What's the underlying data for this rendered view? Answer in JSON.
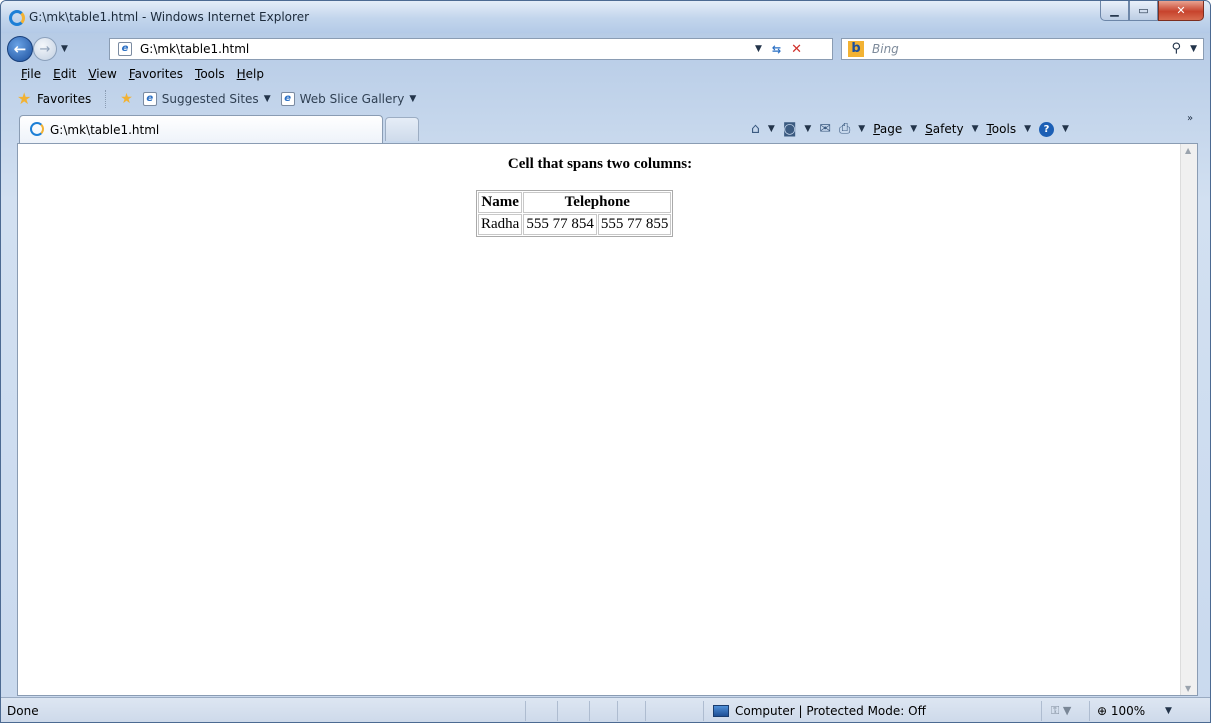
{
  "window": {
    "title": "G:\\mk\\table1.html - Windows Internet Explorer",
    "minimize": "▁",
    "maximize": "▭",
    "close": "✕"
  },
  "address": {
    "url": "G:\\mk\\table1.html",
    "search_placeholder": "Bing"
  },
  "menu": [
    "File",
    "Edit",
    "View",
    "Favorites",
    "Tools",
    "Help"
  ],
  "favorites_bar": {
    "favorites_label": "Favorites",
    "suggested_sites": "Suggested Sites",
    "web_slice_gallery": "Web Slice Gallery"
  },
  "tab": {
    "title": "G:\\mk\\table1.html"
  },
  "command_bar": {
    "page": "Page",
    "safety": "Safety",
    "tools": "Tools"
  },
  "page": {
    "heading": "Cell that spans two columns:",
    "table": {
      "headers": [
        "Name",
        "Telephone"
      ],
      "rows": [
        [
          "Radha",
          "555 77 854",
          "555 77 855"
        ]
      ]
    }
  },
  "status": {
    "text": "Done",
    "zone": "Computer | Protected Mode: Off",
    "zoom": "100%"
  },
  "icons": {
    "back": "back-arrow-icon",
    "forward": "forward-arrow-icon",
    "refresh": "refresh-icon",
    "stop": "stop-icon",
    "search": "search-icon",
    "home": "home-icon",
    "feeds": "feeds-icon",
    "mail": "mail-icon",
    "print": "print-icon",
    "help": "help-icon"
  },
  "colors": {
    "chrome": "#c9d9ee",
    "close_button": "#c7432d",
    "ie_blue": "#1c7fd6"
  }
}
